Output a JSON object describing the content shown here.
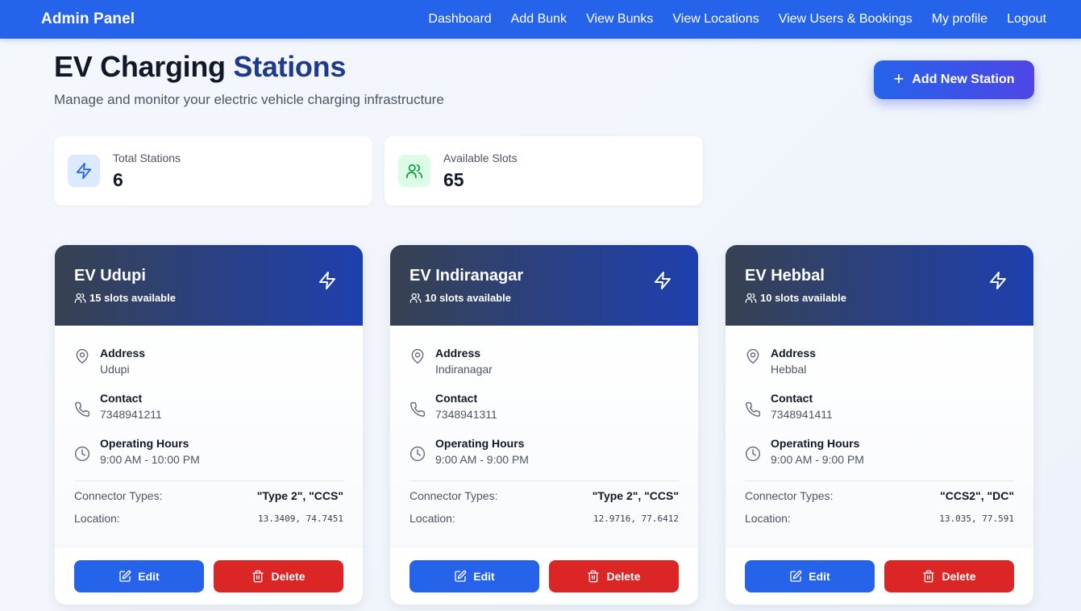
{
  "nav": {
    "brand": "Admin Panel",
    "links": [
      "Dashboard",
      "Add Bunk",
      "View Bunks",
      "View Locations",
      "View Users & Bookings",
      "My profile",
      "Logout"
    ]
  },
  "header": {
    "title_part1": "EV Charging",
    "title_part2": "Stations",
    "subtitle": "Manage and monitor your electric vehicle charging infrastructure",
    "add_button": "Add New Station"
  },
  "stats": [
    {
      "label": "Total Stations",
      "value": "6",
      "icon": "bolt-icon",
      "color": "#2563eb",
      "bg": "#dbeafe"
    },
    {
      "label": "Available Slots",
      "value": "65",
      "icon": "users-icon",
      "color": "#16a34a",
      "bg": "#dcfce7"
    }
  ],
  "labels": {
    "address": "Address",
    "contact": "Contact",
    "hours": "Operating Hours",
    "connector_types": "Connector Types:",
    "location": "Location:",
    "edit": "Edit",
    "delete": "Delete"
  },
  "stations": [
    {
      "name": "EV Udupi",
      "slots": "15 slots available",
      "address": "Udupi",
      "contact": "7348941211",
      "hours": "9:00 AM - 10:00 PM",
      "connectors": "\"Type 2\", \"CCS\"",
      "location": "13.3409, 74.7451"
    },
    {
      "name": "EV Indiranagar",
      "slots": "10 slots available",
      "address": "Indiranagar",
      "contact": "7348941311",
      "hours": "9:00 AM - 9:00 PM",
      "connectors": "\"Type 2\", \"CCS\"",
      "location": "12.9716, 77.6412"
    },
    {
      "name": "EV Hebbal",
      "slots": "10 slots available",
      "address": "Hebbal",
      "contact": "7348941411",
      "hours": "9:00 AM - 9:00 PM",
      "connectors": "\"CCS2\", \"DC\"",
      "location": "13.035, 77.591"
    }
  ],
  "colors": {
    "primary": "#2563eb",
    "danger": "#dc2626",
    "title_accent": "#1e3a8a",
    "card_header_start": "#374151",
    "card_header_end": "#1e40af"
  }
}
